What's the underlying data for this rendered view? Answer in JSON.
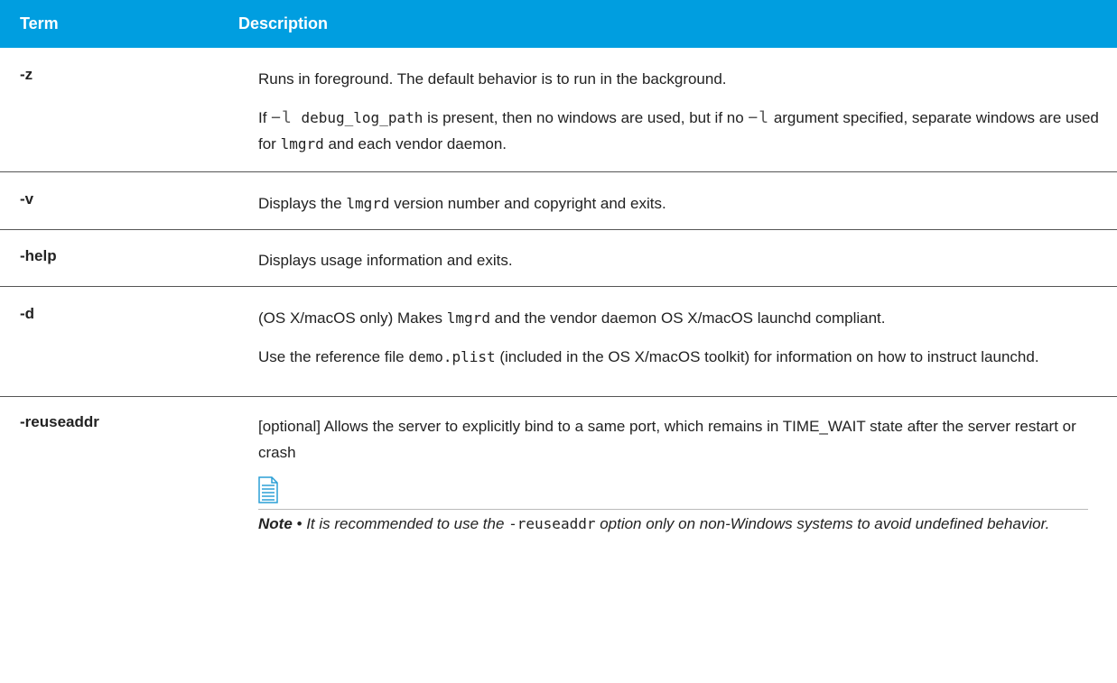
{
  "header": {
    "term": "Term",
    "description": "Description"
  },
  "rows": [
    {
      "term": "-z",
      "p1": "Runs in foreground. The default behavior is to run in the background.",
      "p2_a": "If ",
      "p2_flag": "−l",
      "p2_path": " debug_log_path",
      "p2_b": " is present, then no windows are used, but if no ",
      "p2_flag2": "−l",
      "p2_c": " argument specified, separate windows are used for ",
      "p2_code": "lmgrd",
      "p2_d": " and each vendor daemon."
    },
    {
      "term": "-v",
      "p1_a": "Displays the ",
      "p1_code": "lmgrd",
      "p1_b": " version number and copyright and exits."
    },
    {
      "term": "-help",
      "p1": "Displays usage information and exits."
    },
    {
      "term": "-d",
      "p1_a": "(OS X/macOS only) Makes ",
      "p1_code": "lmgrd",
      "p1_b": " and the vendor daemon OS X/macOS launchd compliant.",
      "p2_a": "Use the reference file ",
      "p2_code": "demo.plist",
      "p2_b": " (included in the OS X/macOS toolkit) for information on how to instruct launchd."
    },
    {
      "term": "-reuseaddr",
      "p1": "[optional] Allows the server to explicitly bind to a same port, which remains in TIME_WAIT state after the server restart or crash",
      "note_icon": "note-document-icon",
      "note_label": "Note",
      "note_bullet": " • ",
      "note_a": "It is recommended to use the ",
      "note_code": "-reuseaddr",
      "note_b": " option only on non-Windows systems to avoid undefined behavior."
    }
  ],
  "colors": {
    "header_bg": "#009ee0",
    "header_text": "#ffffff",
    "icon_stroke": "#2a9fd6"
  }
}
